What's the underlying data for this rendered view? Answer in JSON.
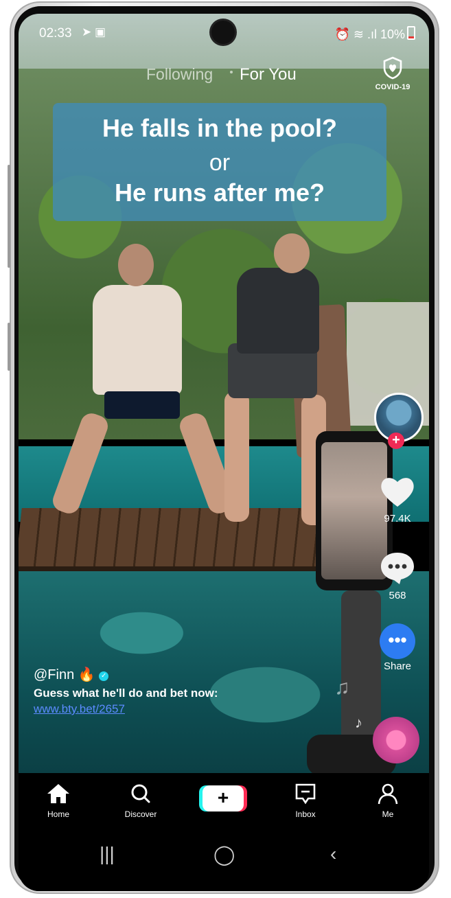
{
  "status_bar": {
    "time": "02:33",
    "left_icons": "➤ ▣",
    "right_icons": "⏰ ≋ .ıl",
    "battery": "10%"
  },
  "feed_tabs": {
    "following": "Following",
    "for_you": "For You"
  },
  "covid": {
    "label": "COVID-19"
  },
  "overlay_caption": {
    "line1": "He falls in the pool?",
    "line2": "or",
    "line3": "He runs after me?"
  },
  "right_rail": {
    "likes": "97.4K",
    "comments": "568",
    "share": "Share"
  },
  "post": {
    "username": "@Finn",
    "emoji": "🔥",
    "caption": "Guess what he'll do and bet now:",
    "link": "www.bty.bet/2657"
  },
  "bottom_nav": {
    "home": "Home",
    "discover": "Discover",
    "create": "+",
    "inbox": "Inbox",
    "me": "Me"
  },
  "system_nav": {
    "recents": "|||",
    "home": "◯",
    "back": "‹"
  },
  "colors": {
    "accent_pink": "#fe2c55",
    "accent_cyan": "#25f4ee",
    "share_blue": "#2d7cf2",
    "caption_box": "#408cb9"
  }
}
